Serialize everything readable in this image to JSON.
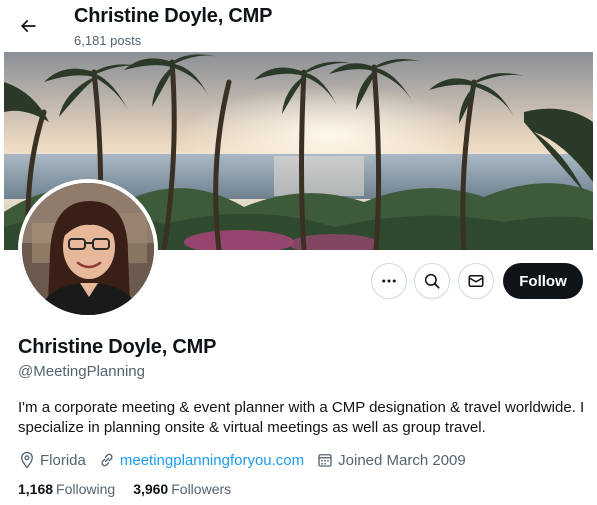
{
  "header": {
    "name": "Christine Doyle, CMP",
    "posts": "6,181 posts",
    "back_icon": "arrow-left-icon"
  },
  "actions": {
    "more_icon": "ellipsis-icon",
    "search_icon": "search-icon",
    "message_icon": "envelope-icon",
    "follow_label": "Follow"
  },
  "profile": {
    "display_name": "Christine Doyle, CMP",
    "handle": "@MeetingPlanning",
    "bio": "I'm a corporate meeting & event planner with a CMP designation & travel worldwide. I specialize in planning onsite & virtual meetings as well as group travel.",
    "location": "Florida",
    "website": "meetingplanningforyou.com",
    "joined": "Joined March 2009"
  },
  "stats": {
    "following_count": "1,168",
    "following_label": "Following",
    "followers_count": "3,960",
    "followers_label": "Followers"
  },
  "colors": {
    "link": "#1d9bf0",
    "secondary_text": "#536471",
    "primary_text": "#0f1419"
  }
}
